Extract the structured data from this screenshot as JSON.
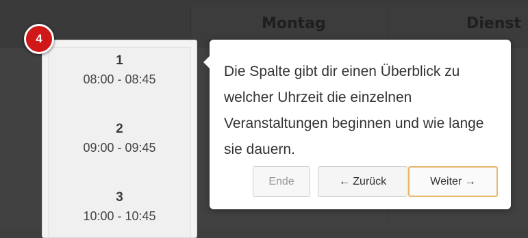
{
  "calendar": {
    "days": [
      "Montag",
      "Dienst"
    ]
  },
  "tour": {
    "step_number": "4",
    "text": "Die Spalte gibt dir einen Überblick zu welcher Uhrzeit die einzelnen Veranstaltungen beginnen und wie lange sie dauern.",
    "buttons": {
      "end": "Ende",
      "back": "← Zurück",
      "next": "Weiter →"
    }
  },
  "time_slots": [
    {
      "number": "1",
      "time": "08:00 - 08:45"
    },
    {
      "number": "2",
      "time": "09:00 - 09:45"
    },
    {
      "number": "3",
      "time": "10:00 - 10:45"
    }
  ],
  "colors": {
    "badge": "#d01818",
    "next_button_border": "#e8b867",
    "overlay": "#3f3f3f"
  }
}
